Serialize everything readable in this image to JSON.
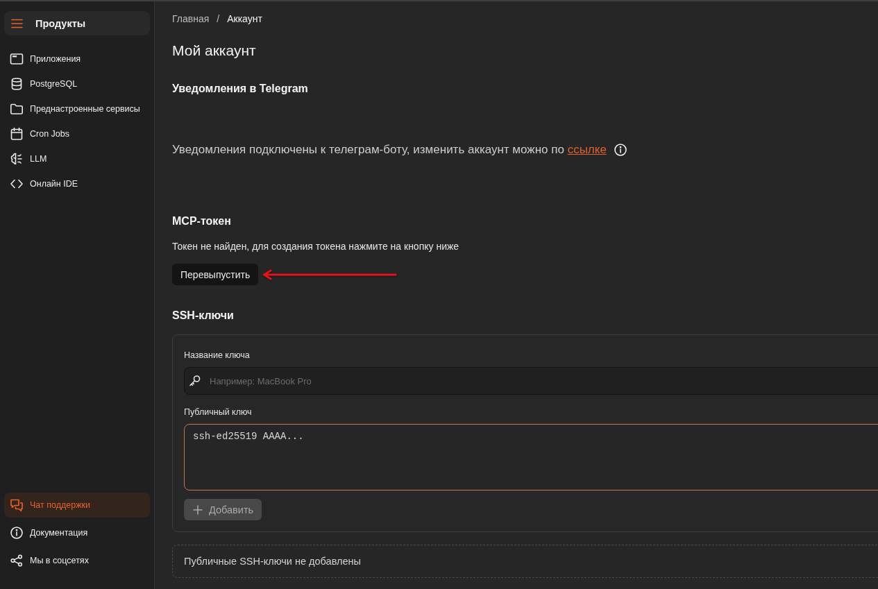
{
  "sidebar": {
    "title": "Продукты",
    "items": [
      {
        "label": "Приложения",
        "selected": false
      },
      {
        "label": "PostgreSQL",
        "selected": false
      },
      {
        "label": "Преднастроенные сервисы",
        "selected": false
      },
      {
        "label": "Cron Jobs",
        "selected": false
      },
      {
        "label": "LLM",
        "selected": false
      },
      {
        "label": "Онлайн IDE",
        "selected": false
      }
    ],
    "footer_items": [
      {
        "label": "Чат поддержки",
        "selected": true
      },
      {
        "label": "Документация",
        "selected": false
      },
      {
        "label": "Мы в соцсетях",
        "selected": false
      }
    ]
  },
  "breadcrumb": {
    "separator": "/",
    "items": [
      {
        "label": "Главная",
        "current": false
      },
      {
        "label": "Аккаунт",
        "current": true
      }
    ]
  },
  "page_title": "Мой аккаунт",
  "telegram": {
    "heading": "Уведомления в Telegram",
    "text": "Уведомления подключены к телеграм-боту, изменить аккаунт можно по",
    "link": "ссылке"
  },
  "mcp_token": {
    "heading": "MCP-токен",
    "text": "Токен не найден, для создания токена нажмите на кнопку ниже",
    "button": "Перевыпустить"
  },
  "ssh_keys": {
    "heading": "SSH-ключи",
    "fields": [
      {
        "kind": "input",
        "label": "Название ключа",
        "placeholder": "Например: MacBook Pro",
        "focused": false
      },
      {
        "kind": "textarea",
        "label": "Публичный ключ",
        "placeholder": "ssh-ed25519 AAAA...",
        "focused": true
      }
    ],
    "add_button": {
      "label": "Добавить",
      "disabled": true
    },
    "empty_state": "Публичные SSH-ключи не добавлены"
  }
}
